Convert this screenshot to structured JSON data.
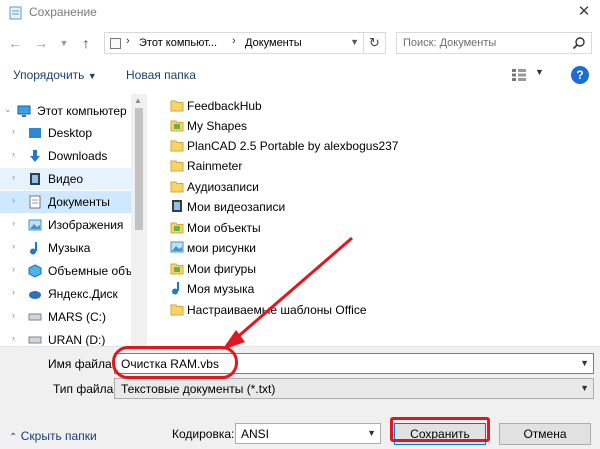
{
  "window": {
    "title": "Сохранение"
  },
  "nav": {
    "breadcrumbs": [
      "Этот компьют...",
      "Документы"
    ],
    "search_placeholder": "Поиск: Документы"
  },
  "toolbar": {
    "organize_label": "Упорядочить",
    "new_folder_label": "Новая папка"
  },
  "sidebar": {
    "items": [
      {
        "label": "Этот компьютер",
        "icon": "computer-icon"
      },
      {
        "label": "Desktop",
        "icon": "desktop-icon"
      },
      {
        "label": "Downloads",
        "icon": "downloads-icon"
      },
      {
        "label": "Видео",
        "icon": "video-icon"
      },
      {
        "label": "Документы",
        "icon": "documents-icon"
      },
      {
        "label": "Изображения",
        "icon": "pictures-icon"
      },
      {
        "label": "Музыка",
        "icon": "music-icon"
      },
      {
        "label": "Объемные объ",
        "icon": "3d-objects-icon"
      },
      {
        "label": "Яндекс.Диск",
        "icon": "yandex-disk-icon"
      },
      {
        "label": "MARS (C:)",
        "icon": "drive-icon"
      },
      {
        "label": "URAN (D:)",
        "icon": "drive-icon"
      }
    ]
  },
  "files": [
    {
      "label": "FeedbackHub",
      "icon": "folder-icon"
    },
    {
      "label": "My Shapes",
      "icon": "special-folder-icon"
    },
    {
      "label": "PlanCAD 2.5 Portable by alexbogus237",
      "icon": "folder-icon"
    },
    {
      "label": "Rainmeter",
      "icon": "folder-icon"
    },
    {
      "label": "Аудиозаписи",
      "icon": "folder-icon"
    },
    {
      "label": "Мои видеозаписи",
      "icon": "video-folder-icon"
    },
    {
      "label": "Мои объекты",
      "icon": "special-folder-icon"
    },
    {
      "label": "мои рисунки",
      "icon": "pictures-folder-icon"
    },
    {
      "label": "Мои фигуры",
      "icon": "special-folder-icon"
    },
    {
      "label": "Моя музыка",
      "icon": "music-folder-icon"
    },
    {
      "label": "Настраиваемые шаблоны Office",
      "icon": "folder-icon"
    }
  ],
  "form": {
    "filename_label": "Имя файла:",
    "filename_value": "Очистка RAM.vbs",
    "filetype_label": "Тип файла:",
    "filetype_value": "Текстовые документы (*.txt)",
    "encoding_label": "Кодировка:",
    "encoding_value": "ANSI",
    "save_label": "Сохранить",
    "cancel_label": "Отмена",
    "hide_folders_label": "Скрыть папки"
  },
  "colors": {
    "annotation": "#e2161e",
    "folder": "#f6d46b",
    "selection": "#cde8ff",
    "link": "#1c3e6e",
    "help": "#1a6fd0"
  }
}
